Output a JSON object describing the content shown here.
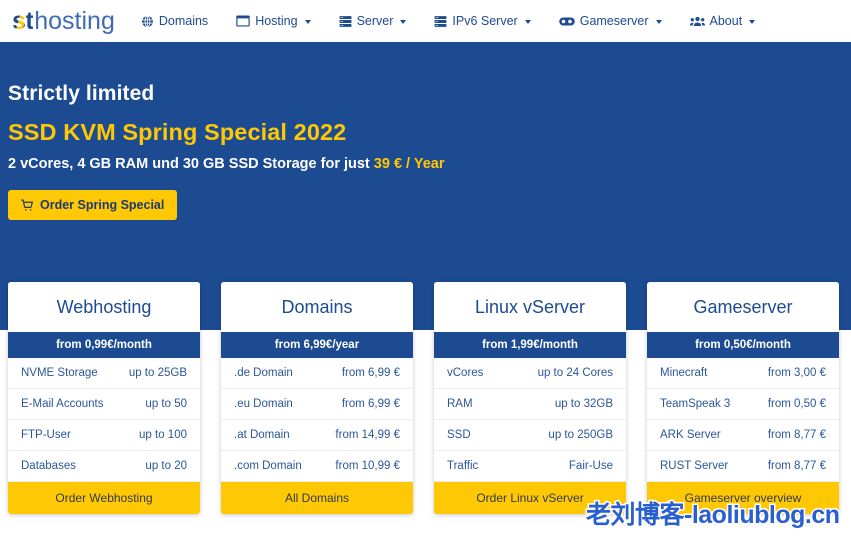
{
  "header": {
    "logo": {
      "mark": "st",
      "rest": "hosting"
    },
    "nav": [
      {
        "label": "Domains",
        "icon": "globe-icon",
        "caret": false
      },
      {
        "label": "Hosting",
        "icon": "browser-icon",
        "caret": true
      },
      {
        "label": "Server",
        "icon": "server-rack-icon",
        "caret": true
      },
      {
        "label": "IPv6 Server",
        "icon": "server-rack-icon",
        "caret": true
      },
      {
        "label": "Gameserver",
        "icon": "gamepad-icon",
        "caret": true
      },
      {
        "label": "About",
        "icon": "people-icon",
        "caret": true
      }
    ]
  },
  "hero": {
    "kicker": "Strictly limited",
    "title": "SSD KVM Spring Special 2022",
    "sub_prefix": "2 vCores, 4 GB RAM und 30 GB SSD Storage for just ",
    "sub_highlight": "39 € / Year",
    "button_label": "Order Spring Special",
    "button_icon": "shopping-cart-icon",
    "bg_color": "#1d4b92",
    "accent_color": "#ffc805"
  },
  "cards": [
    {
      "title": "Webhosting",
      "price": "from 0,99€/month",
      "rows": [
        {
          "label": "NVME Storage",
          "value": "up to 25GB"
        },
        {
          "label": "E-Mail Accounts",
          "value": "up to 50"
        },
        {
          "label": "FTP-User",
          "value": "up to 100"
        },
        {
          "label": "Databases",
          "value": "up to 20"
        }
      ],
      "cta": "Order Webhosting"
    },
    {
      "title": "Domains",
      "price": "from 6,99€/year",
      "rows": [
        {
          "label": ".de Domain",
          "value": "from 6,99 €"
        },
        {
          "label": ".eu Domain",
          "value": "from 6,99 €"
        },
        {
          "label": ".at Domain",
          "value": "from 14,99 €"
        },
        {
          "label": ".com Domain",
          "value": "from 10,99 €"
        }
      ],
      "cta": "All Domains"
    },
    {
      "title": "Linux vServer",
      "price": "from 1,99€/month",
      "rows": [
        {
          "label": "vCores",
          "value": "up to 24 Cores"
        },
        {
          "label": "RAM",
          "value": "up to 32GB"
        },
        {
          "label": "SSD",
          "value": "up to 250GB"
        },
        {
          "label": "Traffic",
          "value": "Fair-Use"
        }
      ],
      "cta": "Order Linux vServer"
    },
    {
      "title": "Gameserver",
      "price": "from 0,50€/month",
      "rows": [
        {
          "label": "Minecraft",
          "value": "from 3,00 €"
        },
        {
          "label": "TeamSpeak 3",
          "value": "from 0,50 €"
        },
        {
          "label": "ARK Server",
          "value": "from 8,77 €"
        },
        {
          "label": "RUST Server",
          "value": "from 8,77 €"
        }
      ],
      "cta": "Gameserver overview"
    }
  ],
  "watermark": {
    "text": "老刘博客-laoliublog.cn",
    "color": "#2a5fd0"
  }
}
